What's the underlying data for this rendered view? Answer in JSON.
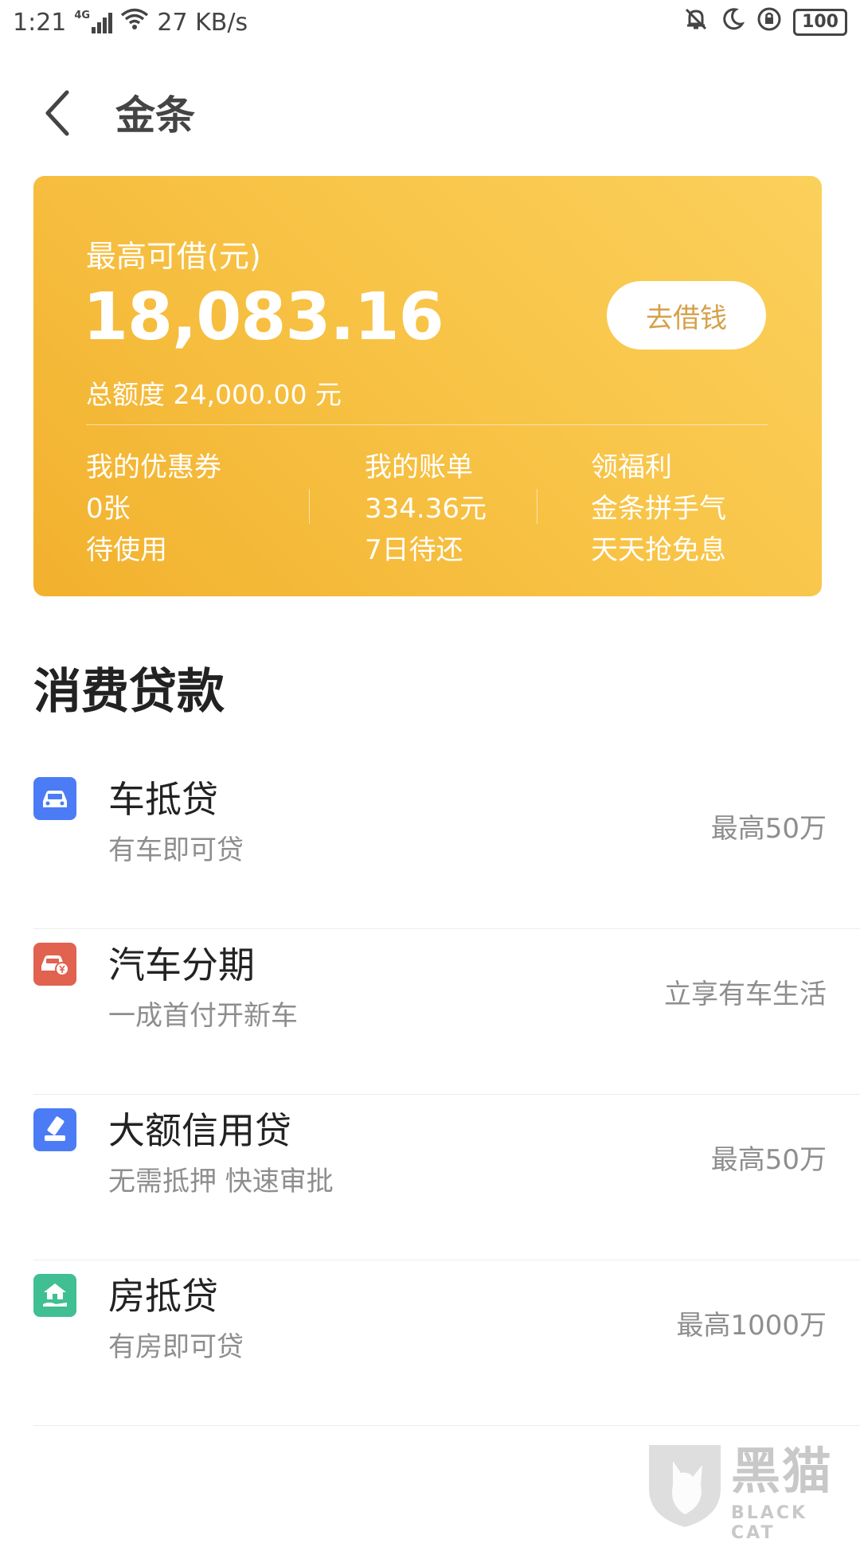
{
  "status_bar": {
    "time": "1:21",
    "network": "4G",
    "speed": "27 KB/s",
    "battery": "100"
  },
  "header": {
    "title": "金条"
  },
  "credit_card": {
    "label": "最高可借(元)",
    "amount": "18,083.16",
    "total": "总额度 24,000.00 元",
    "borrow_button": "去借钱",
    "stats": [
      {
        "title": "我的优惠券",
        "line1": "0张",
        "line2": "待使用"
      },
      {
        "title": "我的账单",
        "line1": "334.36元",
        "line2": "7日待还"
      },
      {
        "title": "领福利",
        "line1": "金条拼手气",
        "line2": "天天抢免息"
      }
    ]
  },
  "section": {
    "title": "消费贷款"
  },
  "loans": [
    {
      "title": "车抵贷",
      "subtitle": "有车即可贷",
      "right": "最高50万",
      "icon": "car-icon",
      "color": "#4c7cf5"
    },
    {
      "title": "汽车分期",
      "subtitle": "一成首付开新车",
      "right": "立享有车生活",
      "icon": "car-yuan-icon",
      "color": "#e0624f"
    },
    {
      "title": "大额信用贷",
      "subtitle": "无需抵押 快速审批",
      "right": "最高50万",
      "icon": "card-stamp-icon",
      "color": "#4c7cf5"
    },
    {
      "title": "房抵贷",
      "subtitle": "有房即可贷",
      "right": "最高1000万",
      "icon": "house-hand-icon",
      "color": "#3fbf92"
    }
  ],
  "watermark": {
    "chinese": "黑猫",
    "english": "BLACK CAT"
  }
}
